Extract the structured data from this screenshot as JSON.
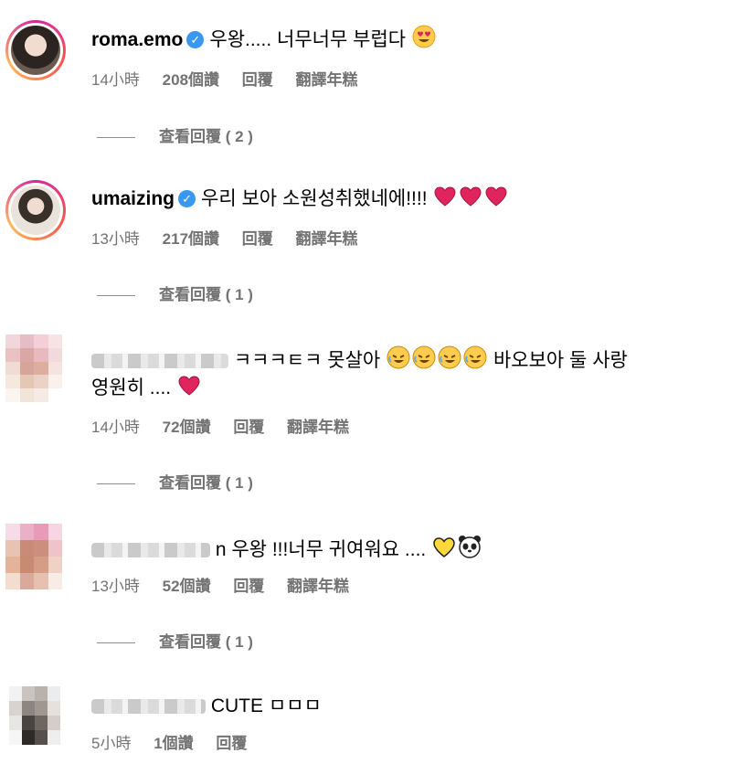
{
  "comments": [
    {
      "username": "roma.emo",
      "verified": true,
      "text": "우왕..... 너무너무 부럽다",
      "emojis": [
        "heart-eyes"
      ],
      "time": "14小時",
      "likes": "208個讚",
      "reply": "回覆",
      "translate": "翻譯年糕",
      "view_replies": "查看回覆 ( 2 )"
    },
    {
      "username": "umaizing",
      "verified": true,
      "text": "우리 보아 소원성취했네에!!!!",
      "emojis": [
        "red-heart",
        "red-heart",
        "red-heart"
      ],
      "time": "13小時",
      "likes": "217個讚",
      "reply": "回覆",
      "translate": "翻譯年糕",
      "view_replies": "查看回覆 ( 1 )"
    },
    {
      "username_blurred": true,
      "text_line1": "ㅋㅋㅋㅌㅋ 못살아",
      "text_line1_tail": "바오보아 둘 사랑",
      "text_line2": "영원히 ....",
      "emojis": [
        "rofl",
        "rofl",
        "rofl",
        "rofl",
        "red-heart"
      ],
      "time": "14小時",
      "likes": "72個讚",
      "reply": "回覆",
      "translate": "翻譯年糕",
      "view_replies": "查看回覆 ( 1 )"
    },
    {
      "username_blurred": true,
      "text": "n 우왕 !!!너무 귀여워요 ....",
      "emojis": [
        "yellow-heart",
        "panda"
      ],
      "time": "13小時",
      "likes": "52個讚",
      "reply": "回覆",
      "translate": "翻譯年糕",
      "view_replies": "查看回覆 ( 1 )"
    },
    {
      "username_blurred": true,
      "text": "CUTE ㅁㅁㅁ",
      "time": "5小時",
      "likes": "1個讚",
      "reply": "回覆"
    }
  ],
  "colors": {
    "meta_gray": "#737373",
    "verified_blue": "#3897f0",
    "heart_red": "#e0245e"
  }
}
